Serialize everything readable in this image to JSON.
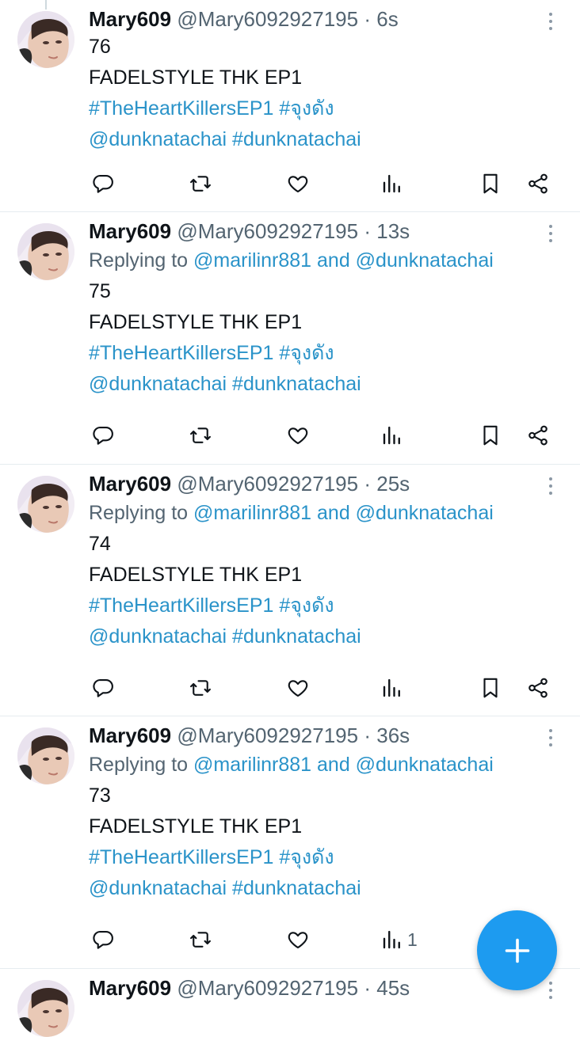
{
  "tweets": [
    {
      "name": "Mary609",
      "handle": "@Mary6092927195",
      "sep": "·",
      "time": "6s",
      "reply": null,
      "number": "76",
      "text": "FADELSTYLE THK EP1",
      "tags1": "#TheHeartKillersEP1  #จุงดัง",
      "tags2": "@dunknatachai #dunknatachai",
      "views": ""
    },
    {
      "name": "Mary609",
      "handle": "@Mary6092927195",
      "sep": "·",
      "time": "13s",
      "reply": {
        "prefix": "Replying to ",
        "users": "@marilinr881 and @dunknatachai"
      },
      "number": "75",
      "text": "FADELSTYLE THK EP1",
      "tags1": "#TheHeartKillersEP1  #จุงดัง",
      "tags2": "@dunknatachai #dunknatachai",
      "views": ""
    },
    {
      "name": "Mary609",
      "handle": "@Mary6092927195",
      "sep": "·",
      "time": "25s",
      "reply": {
        "prefix": "Replying to ",
        "users": "@marilinr881 and @dunknatachai"
      },
      "number": "74",
      "text": "FADELSTYLE THK EP1",
      "tags1": "#TheHeartKillersEP1  #จุงดัง",
      "tags2": "@dunknatachai #dunknatachai",
      "views": ""
    },
    {
      "name": "Mary609",
      "handle": "@Mary6092927195",
      "sep": "·",
      "time": "36s",
      "reply": {
        "prefix": "Replying to ",
        "users": "@marilinr881 and @dunknatachai"
      },
      "number": "73",
      "text": "FADELSTYLE THK EP1",
      "tags1": "#TheHeartKillersEP1  #จุงดัง",
      "tags2": "@dunknatachai #dunknatachai",
      "views": "1"
    },
    {
      "name": "Mary609",
      "handle": "@Mary6092927195",
      "sep": "·",
      "time": "45s",
      "reply": null,
      "number": "",
      "text": "",
      "tags1": "",
      "tags2": "",
      "views": ""
    }
  ],
  "icons": {
    "reply": "reply-icon",
    "retweet": "retweet-icon",
    "like": "like-icon",
    "views": "views-icon",
    "bookmark": "bookmark-icon",
    "share": "share-icon",
    "more": "more-icon",
    "compose": "compose-plus-icon"
  },
  "colors": {
    "link": "#2a93c9",
    "fab": "#1d9bf0",
    "muted": "#536471"
  }
}
